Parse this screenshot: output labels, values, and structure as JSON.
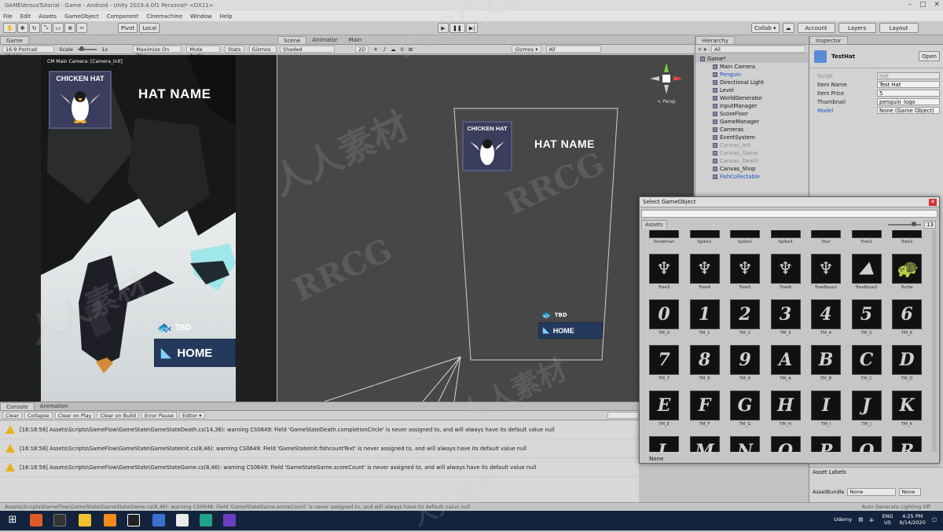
{
  "window": {
    "title": "GAMEVersusTutorial - Game - Android - Unity 2019.4.0f1 Personal* <DX11>"
  },
  "menu": [
    "File",
    "Edit",
    "Assets",
    "GameObject",
    "Component",
    "Cinemachine",
    "Window",
    "Help"
  ],
  "toolbar": {
    "pivot": "Pivot",
    "local": "Local",
    "collab": "Collab ▾",
    "account": "Account",
    "layers": "Layers",
    "layout": "Layout"
  },
  "game": {
    "tab": "Game",
    "resolution": "16:9 Portrait (9:16)",
    "scale_label": "Scale",
    "scale_value": "1x",
    "maximize": "Maximize On Play",
    "mute": "Mute Audio",
    "stats": "Stats",
    "gizmos": "Gizmos ▾",
    "camera_label": "CM Main Camera: [Camera_Init]",
    "hat_title": "CHICKEN HAT",
    "hat_name": "HAT NAME",
    "coin_text": "TBD",
    "home": "HOME"
  },
  "scene": {
    "tabs": [
      "Scene",
      "Animator",
      "Main"
    ],
    "shading": "Shaded",
    "mode_2d": "2D",
    "gizmos": "Gizmos ▾",
    "search": "All",
    "layers_count": "0",
    "persp": "< Persp",
    "hat_title": "CHICKEN HAT",
    "hat_name": "HAT NAME",
    "coin_text": "TBD",
    "home": "HOME"
  },
  "hierarchy": {
    "tab": "Hierarchy",
    "create": "+ ▾",
    "search": "All",
    "items": [
      {
        "label": "Game*",
        "style": "root"
      },
      {
        "label": "Main Camera",
        "style": "normal"
      },
      {
        "label": "Penguin",
        "style": "blue"
      },
      {
        "label": "Directional Light",
        "style": "normal"
      },
      {
        "label": "Level",
        "style": "normal"
      },
      {
        "label": "WorldGenerator",
        "style": "normal"
      },
      {
        "label": "InputManager",
        "style": "normal"
      },
      {
        "label": "ScoreFloor",
        "style": "normal"
      },
      {
        "label": "GameManager",
        "style": "normal"
      },
      {
        "label": "Cameras",
        "style": "normal"
      },
      {
        "label": "EventSystem",
        "style": "normal"
      },
      {
        "label": "Canvas_Init",
        "style": "gray"
      },
      {
        "label": "Canvas_Game",
        "style": "gray"
      },
      {
        "label": "Canvas_Death",
        "style": "gray"
      },
      {
        "label": "Canvas_Shop",
        "style": "normal"
      },
      {
        "label": "FishCollectable",
        "style": "blue"
      }
    ]
  },
  "inspector": {
    "tab": "Inspector",
    "object": "TestHat",
    "open": "Open",
    "script_label": "Script",
    "script_value": "Hat",
    "fields": [
      {
        "label": "Item Name",
        "value": "Test Hat"
      },
      {
        "label": "Item Price",
        "value": "5"
      },
      {
        "label": "Thumbnail",
        "value": "penguin_logo"
      },
      {
        "label": "Model",
        "value": "None (Game Object)"
      }
    ],
    "asset_labels": "Asset Labels",
    "assetbundle_label": "AssetBundle",
    "assetbundle_value": "None",
    "assetbundle_variant": "None"
  },
  "picker": {
    "title": "Select GameObject",
    "tab": "Assets",
    "count": "13",
    "rows": [
      [
        "Snowman",
        "Spike1",
        "Spike2",
        "Spike3",
        "Star",
        "Tree1",
        "Tree2"
      ],
      [
        "Tree3",
        "Tree4",
        "Tree5",
        "Tree6",
        "TreeBase1",
        "TreeBase2",
        "Turtle"
      ],
      [
        "TM_0",
        "TM_1",
        "TM_2",
        "TM_3",
        "TM_4",
        "TM_5",
        "TM_6"
      ],
      [
        "TM_7",
        "TM_8",
        "TM_9",
        "TM_A",
        "TM_B",
        "TM_C",
        "TM_D"
      ],
      [
        "TM_E",
        "TM_F",
        "TM_G",
        "TM_H",
        "TM_I",
        "TM_J",
        "TM_K"
      ],
      [
        "",
        "",
        "",
        "",
        "",
        "",
        ""
      ]
    ],
    "glyphs": [
      [
        "",
        "",
        "",
        "",
        "",
        "",
        ""
      ],
      [
        "♆",
        "♆",
        "♆",
        "♆",
        "♆",
        "⛰",
        "🐢"
      ],
      [
        "0",
        "1",
        "2",
        "3",
        "4",
        "5",
        "6"
      ],
      [
        "7",
        "8",
        "9",
        "A",
        "B",
        "C",
        "D"
      ],
      [
        "E",
        "F",
        "G",
        "H",
        "I",
        "J",
        "K"
      ],
      [
        "L",
        "M",
        "N",
        "O",
        "P",
        "Q",
        "R"
      ]
    ],
    "footer": "None"
  },
  "console": {
    "tabs": [
      "Console",
      "Animation"
    ],
    "buttons": [
      "Clear",
      "Collapse",
      "Clear on Play",
      "Clear on Build",
      "Error Pause",
      "Editor ▾"
    ],
    "logs": [
      "[16:18:58] Assets\\Scripts\\GameFlow\\GameState\\GameStateDeath.cs(14,36): warning CS0649: Field 'GameStateDeath.completionCircle' is never assigned to, and will always have its default value null",
      "[16:18:58] Assets\\Scripts\\GameFlow\\GameState\\GameStateInit.cs(8,46): warning CS0649: Field 'GameStateInit.fishcountText' is never assigned to, and will always have its default value null",
      "[16:18:58] Assets\\Scripts\\GameFlow\\GameState\\GameStateGame.cs(8,46): warning CS0649: Field 'GameStateGame.scoreCount' is never assigned to, and will always have its default value null"
    ]
  },
  "status": {
    "message": "Assets\\Scripts\\GameFlow\\GameState\\GameStateGame.cs(8,46): warning CS0649: Field 'GameStateGame.scoreCount' is never assigned to, and will always have its default value null",
    "lighting": "Auto Generate Lighting Off"
  },
  "taskbar": {
    "time": "4:25 PM",
    "date": "9/14/2020",
    "lang": "ENG",
    "region": "US",
    "brand": "Udemy"
  },
  "watermarks": [
    "RRCG.CN",
    "人人素材",
    "RRCG"
  ],
  "colors": {
    "unity_blue": "#1852c2",
    "hat_bg": "#3a3d5c",
    "home_bg": "#24395b",
    "warning": "#e6b21c",
    "taskbar": "#14233d"
  }
}
